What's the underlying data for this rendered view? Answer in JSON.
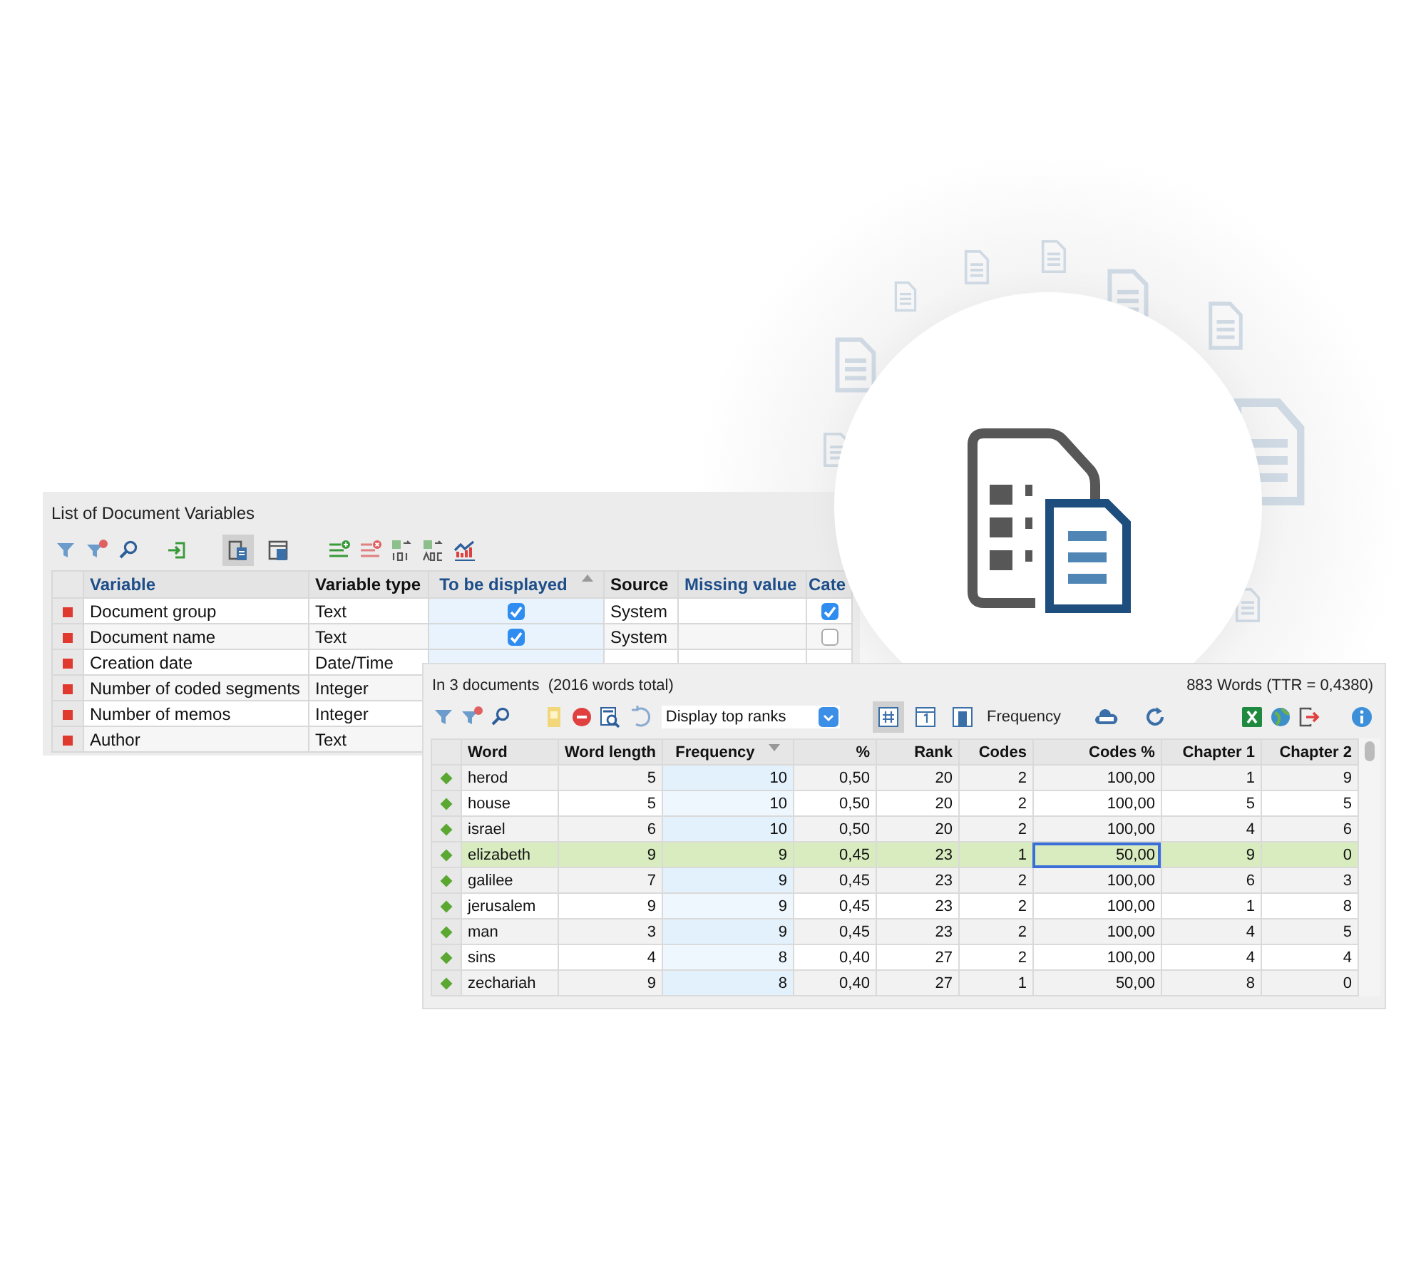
{
  "variables_window": {
    "title": "List of Document Variables",
    "view_toggles": [
      {
        "selected": true
      },
      {
        "selected": false
      }
    ],
    "columns": [
      {
        "label": "Variable",
        "accent": true,
        "sorted": false
      },
      {
        "label": "Variable type",
        "accent": false,
        "sorted": false
      },
      {
        "label": "To be displayed",
        "accent": true,
        "sorted": true,
        "descending": false
      },
      {
        "label": "Source",
        "accent": false,
        "sorted": false
      },
      {
        "label": "Missing value",
        "accent": true,
        "sorted": false
      },
      {
        "label": "Cate",
        "accent": true,
        "sorted": false
      }
    ],
    "rows": [
      {
        "variable": "Document group",
        "type": "Text",
        "displayed": true,
        "source": "System",
        "category": true
      },
      {
        "variable": "Document name",
        "type": "Text",
        "displayed": true,
        "source": "System",
        "category": false
      },
      {
        "variable": "Creation date",
        "type": "Date/Time"
      },
      {
        "variable": "Number of coded segments",
        "type": "Integer"
      },
      {
        "variable": "Number of memos",
        "type": "Integer"
      },
      {
        "variable": "Author",
        "type": "Text"
      }
    ]
  },
  "word_window": {
    "summary": "In 3 documents  (2016 words total)",
    "total": "883 Words (TTR = 0,4380)",
    "dropdown": {
      "value": "Display top ranks"
    },
    "view_toggles": [
      {
        "selected": true
      },
      {
        "selected": false
      },
      {
        "selected": false
      }
    ],
    "sort_label": "Frequency",
    "columns": [
      {
        "label": "Word",
        "sorted": false
      },
      {
        "label": "Word length",
        "sorted": false
      },
      {
        "label": "Frequency",
        "sorted": true,
        "descending": true
      },
      {
        "label": "%",
        "sorted": false
      },
      {
        "label": "Rank",
        "sorted": false
      },
      {
        "label": "Codes",
        "sorted": false
      },
      {
        "label": "Codes %",
        "sorted": false
      },
      {
        "label": "Chapter 1",
        "sorted": false
      },
      {
        "label": "Chapter 2",
        "sorted": false
      }
    ],
    "rows": [
      {
        "selected": false,
        "cells": [
          "herod",
          "5",
          "10",
          "0,50",
          "20",
          "2",
          "100,00",
          "1",
          "9"
        ],
        "focus": [
          false,
          false,
          false,
          false,
          false,
          false,
          false,
          false,
          false
        ]
      },
      {
        "selected": false,
        "cells": [
          "house",
          "5",
          "10",
          "0,50",
          "20",
          "2",
          "100,00",
          "5",
          "5"
        ],
        "focus": [
          false,
          false,
          false,
          false,
          false,
          false,
          false,
          false,
          false
        ]
      },
      {
        "selected": false,
        "cells": [
          "israel",
          "6",
          "10",
          "0,50",
          "20",
          "2",
          "100,00",
          "4",
          "6"
        ],
        "focus": [
          false,
          false,
          false,
          false,
          false,
          false,
          false,
          false,
          false
        ]
      },
      {
        "selected": true,
        "cells": [
          "elizabeth",
          "9",
          "9",
          "0,45",
          "23",
          "1",
          "50,00",
          "9",
          "0"
        ],
        "focus": [
          false,
          false,
          false,
          false,
          false,
          false,
          true,
          false,
          false
        ]
      },
      {
        "selected": false,
        "cells": [
          "galilee",
          "7",
          "9",
          "0,45",
          "23",
          "2",
          "100,00",
          "6",
          "3"
        ],
        "focus": [
          false,
          false,
          false,
          false,
          false,
          false,
          false,
          false,
          false
        ]
      },
      {
        "selected": false,
        "cells": [
          "jerusalem",
          "9",
          "9",
          "0,45",
          "23",
          "2",
          "100,00",
          "1",
          "8"
        ],
        "focus": [
          false,
          false,
          false,
          false,
          false,
          false,
          false,
          false,
          false
        ]
      },
      {
        "selected": false,
        "cells": [
          "man",
          "3",
          "9",
          "0,45",
          "23",
          "2",
          "100,00",
          "4",
          "5"
        ],
        "focus": [
          false,
          false,
          false,
          false,
          false,
          false,
          false,
          false,
          false
        ]
      },
      {
        "selected": false,
        "cells": [
          "sins",
          "4",
          "8",
          "0,40",
          "27",
          "2",
          "100,00",
          "4",
          "4"
        ],
        "focus": [
          false,
          false,
          false,
          false,
          false,
          false,
          false,
          false,
          false
        ]
      },
      {
        "selected": false,
        "cells": [
          "zechariah",
          "9",
          "8",
          "0,40",
          "27",
          "1",
          "50,00",
          "8",
          "0"
        ],
        "focus": [
          false,
          false,
          false,
          false,
          false,
          false,
          false,
          false,
          false
        ]
      }
    ]
  }
}
